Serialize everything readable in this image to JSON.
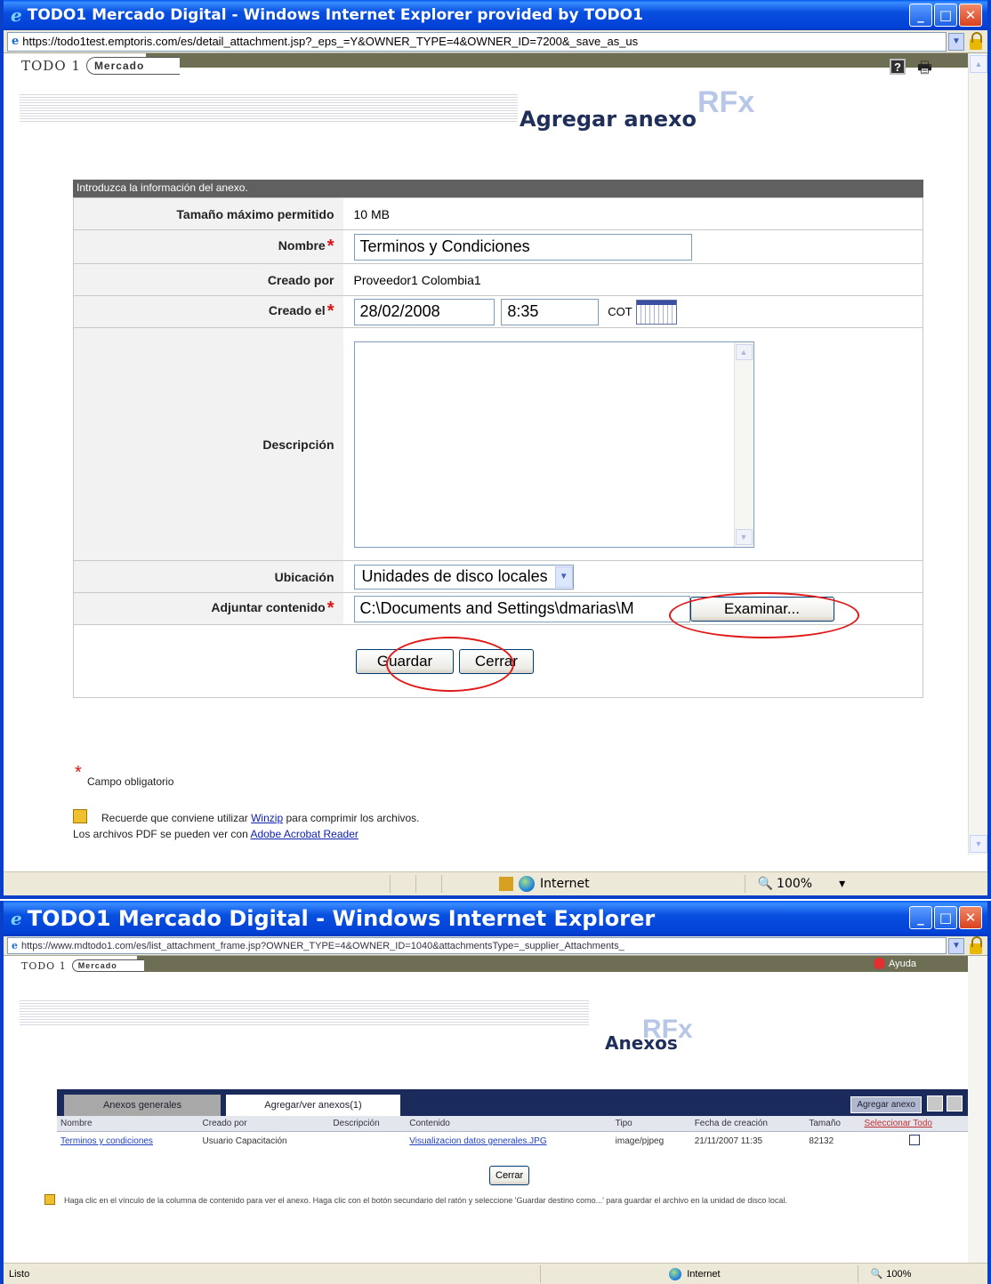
{
  "window1": {
    "title": "TODO1 Mercado Digital - Windows Internet Explorer provided by TODO1",
    "url": "https://todo1test.emptoris.com/es/detail_attachment.jsp?_eps_=Y&OWNER_TYPE=4&OWNER_ID=7200&_save_as_us",
    "logo_text": "TODO 1",
    "logo_pill": "Mercado",
    "rfx": "RFx",
    "page_title": "Agregar anexo",
    "form_header": "Introduzca la información del anexo.",
    "fields": {
      "max_size_label": "Tamaño máximo permitido",
      "max_size_value": "10 MB",
      "name_label": "Nombre",
      "name_value": "Terminos y Condiciones",
      "created_by_label": "Creado por",
      "created_by_value": "Proveedor1 Colombia1",
      "created_on_label": "Creado el",
      "date_value": "28/02/2008",
      "time_value": "8:35",
      "timezone": "COT",
      "description_label": "Descripción",
      "location_label": "Ubicación",
      "location_value": "Unidades de disco locales",
      "attach_label": "Adjuntar contenido",
      "attach_value": "C:\\Documents and Settings\\dmarias\\M",
      "browse_label": "Examinar..."
    },
    "buttons": {
      "save": "Guardar",
      "close": "Cerrar"
    },
    "required_note": "Campo obligatorio",
    "winzip_pre": "Recuerde que conviene utilizar",
    "winzip_link": "Winzip",
    "winzip_post": "para comprimir los archivos.",
    "pdf_pre": "Los archivos PDF se pueden ver con",
    "pdf_link": "Adobe Acrobat Reader",
    "status_zone": "Internet",
    "zoom": "100%"
  },
  "window2": {
    "title": "TODO1 Mercado Digital - Windows Internet Explorer",
    "url": "https://www.mdtodo1.com/es/list_attachment_frame.jsp?OWNER_TYPE=4&OWNER_ID=1040&attachmentsType=_supplier_Attachments_",
    "logo_text": "TODO 1",
    "logo_pill": "Mercado",
    "help": "Ayuda",
    "rfx": "RFx",
    "page_title": "Anexos",
    "tabs": [
      "Anexos generales",
      "Agregar/ver anexos(1)"
    ],
    "add_button": "Agregar anexo",
    "columns": [
      "Nombre",
      "Creado por",
      "Descripción",
      "Contenido",
      "Tipo",
      "Fecha de creación",
      "Tamaño",
      "Seleccionar Todo"
    ],
    "rows": [
      {
        "nombre": "Terminos y condiciones",
        "creado_por": "Usuario Capacitación",
        "descripcion": "",
        "contenido": "Visualizacion datos generales.JPG",
        "tipo": "image/pjpeg",
        "fecha": "21/11/2007 11:35",
        "tamano": "82132"
      }
    ],
    "close": "Cerrar",
    "note": "Haga clic en el vínculo de la columna de contenido para ver el anexo. Haga clic con el botón secundario del ratón y seleccione 'Guardar destino como...' para guardar el archivo en la unidad de disco local.",
    "status_left": "Listo",
    "status_zone": "Internet",
    "zoom": "100%"
  }
}
